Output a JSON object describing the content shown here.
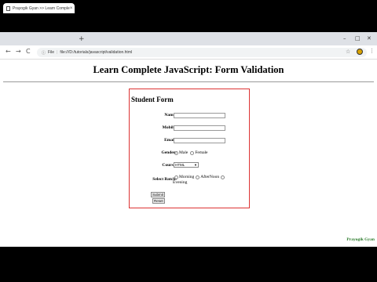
{
  "browser": {
    "tab_title": "Prayogik Gyan >> Learn Comple",
    "tab_close": "×",
    "new_tab": "+",
    "win_min": "–",
    "win_max": "□",
    "win_close": "✕",
    "nav_back": "←",
    "nav_forward": "→",
    "nav_reload": "C",
    "info_icon": "ⓘ",
    "scheme_label": "File",
    "separator": "|",
    "url": "file:///D:/tutorials/javascript/validation.html",
    "star": "☆",
    "menu": "⋮"
  },
  "page": {
    "heading": "Learn Complete JavaScript: Form Validation",
    "footer": "Prayogik Gyan"
  },
  "form": {
    "title": "Student Form",
    "name_label": "Name:",
    "mobile_label": "Mobile:",
    "email_label": "Email:",
    "gender_label": "Gender:",
    "gender_options": [
      "Male",
      "Female"
    ],
    "course_label": "Course:",
    "course_selected": "HTML",
    "batch_label": "Select Batch:",
    "batch_options": [
      "Morning",
      "AfterNoon",
      "Evening"
    ],
    "submit_label": "Submit",
    "reset_label": "Reset"
  },
  "colors": {
    "form_border": "#dd3333",
    "footer_text": "#2a7a2a"
  }
}
